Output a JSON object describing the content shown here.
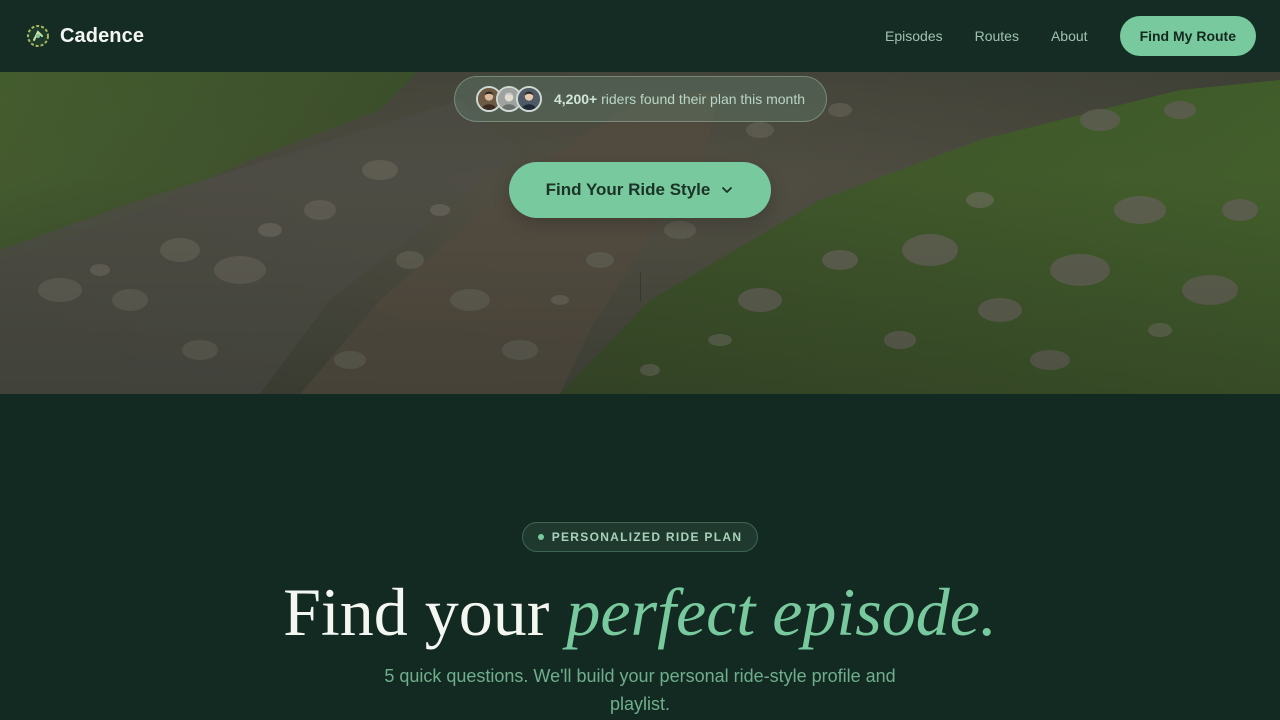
{
  "nav": {
    "brand": "Cadence",
    "links": [
      "Episodes",
      "Routes",
      "About"
    ],
    "cta": "Find My Route"
  },
  "hero": {
    "proof": {
      "count": "4,200+",
      "text": "riders found their plan this month"
    },
    "ride_button": "Find Your Ride Style"
  },
  "section": {
    "badge": "PERSONALIZED RIDE PLAN",
    "headline_plain": "Find your",
    "headline_emphasis": "perfect episode.",
    "subtitle": "5 quick questions. We'll build your personal ride-style profile and playlist."
  },
  "colors": {
    "accent": "#78c99d",
    "background": "#132a22",
    "nav_background": "#152c24",
    "text_light": "#f4f6f1"
  },
  "icons": [
    "cycling-logo-icon",
    "chevron-down-icon",
    "scroll-chevron-icon"
  ]
}
